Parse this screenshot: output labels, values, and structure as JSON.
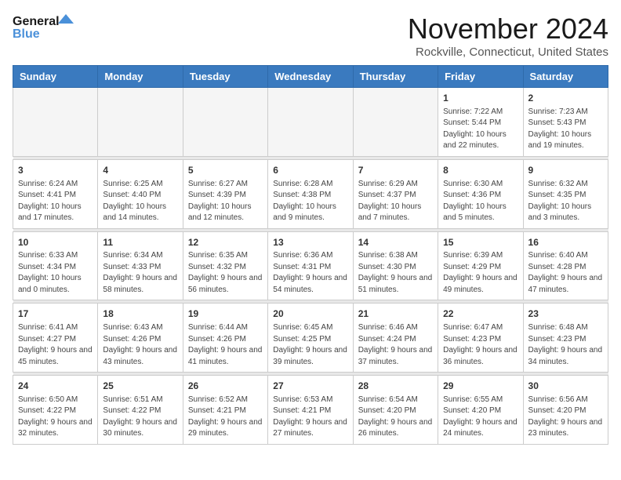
{
  "logo": {
    "line1": "General",
    "line2": "Blue"
  },
  "title": "November 2024",
  "location": "Rockville, Connecticut, United States",
  "weekdays": [
    "Sunday",
    "Monday",
    "Tuesday",
    "Wednesday",
    "Thursday",
    "Friday",
    "Saturday"
  ],
  "weeks": [
    [
      {
        "day": "",
        "info": ""
      },
      {
        "day": "",
        "info": ""
      },
      {
        "day": "",
        "info": ""
      },
      {
        "day": "",
        "info": ""
      },
      {
        "day": "",
        "info": ""
      },
      {
        "day": "1",
        "info": "Sunrise: 7:22 AM\nSunset: 5:44 PM\nDaylight: 10 hours and 22 minutes."
      },
      {
        "day": "2",
        "info": "Sunrise: 7:23 AM\nSunset: 5:43 PM\nDaylight: 10 hours and 19 minutes."
      }
    ],
    [
      {
        "day": "3",
        "info": "Sunrise: 6:24 AM\nSunset: 4:41 PM\nDaylight: 10 hours and 17 minutes."
      },
      {
        "day": "4",
        "info": "Sunrise: 6:25 AM\nSunset: 4:40 PM\nDaylight: 10 hours and 14 minutes."
      },
      {
        "day": "5",
        "info": "Sunrise: 6:27 AM\nSunset: 4:39 PM\nDaylight: 10 hours and 12 minutes."
      },
      {
        "day": "6",
        "info": "Sunrise: 6:28 AM\nSunset: 4:38 PM\nDaylight: 10 hours and 9 minutes."
      },
      {
        "day": "7",
        "info": "Sunrise: 6:29 AM\nSunset: 4:37 PM\nDaylight: 10 hours and 7 minutes."
      },
      {
        "day": "8",
        "info": "Sunrise: 6:30 AM\nSunset: 4:36 PM\nDaylight: 10 hours and 5 minutes."
      },
      {
        "day": "9",
        "info": "Sunrise: 6:32 AM\nSunset: 4:35 PM\nDaylight: 10 hours and 3 minutes."
      }
    ],
    [
      {
        "day": "10",
        "info": "Sunrise: 6:33 AM\nSunset: 4:34 PM\nDaylight: 10 hours and 0 minutes."
      },
      {
        "day": "11",
        "info": "Sunrise: 6:34 AM\nSunset: 4:33 PM\nDaylight: 9 hours and 58 minutes."
      },
      {
        "day": "12",
        "info": "Sunrise: 6:35 AM\nSunset: 4:32 PM\nDaylight: 9 hours and 56 minutes."
      },
      {
        "day": "13",
        "info": "Sunrise: 6:36 AM\nSunset: 4:31 PM\nDaylight: 9 hours and 54 minutes."
      },
      {
        "day": "14",
        "info": "Sunrise: 6:38 AM\nSunset: 4:30 PM\nDaylight: 9 hours and 51 minutes."
      },
      {
        "day": "15",
        "info": "Sunrise: 6:39 AM\nSunset: 4:29 PM\nDaylight: 9 hours and 49 minutes."
      },
      {
        "day": "16",
        "info": "Sunrise: 6:40 AM\nSunset: 4:28 PM\nDaylight: 9 hours and 47 minutes."
      }
    ],
    [
      {
        "day": "17",
        "info": "Sunrise: 6:41 AM\nSunset: 4:27 PM\nDaylight: 9 hours and 45 minutes."
      },
      {
        "day": "18",
        "info": "Sunrise: 6:43 AM\nSunset: 4:26 PM\nDaylight: 9 hours and 43 minutes."
      },
      {
        "day": "19",
        "info": "Sunrise: 6:44 AM\nSunset: 4:26 PM\nDaylight: 9 hours and 41 minutes."
      },
      {
        "day": "20",
        "info": "Sunrise: 6:45 AM\nSunset: 4:25 PM\nDaylight: 9 hours and 39 minutes."
      },
      {
        "day": "21",
        "info": "Sunrise: 6:46 AM\nSunset: 4:24 PM\nDaylight: 9 hours and 37 minutes."
      },
      {
        "day": "22",
        "info": "Sunrise: 6:47 AM\nSunset: 4:23 PM\nDaylight: 9 hours and 36 minutes."
      },
      {
        "day": "23",
        "info": "Sunrise: 6:48 AM\nSunset: 4:23 PM\nDaylight: 9 hours and 34 minutes."
      }
    ],
    [
      {
        "day": "24",
        "info": "Sunrise: 6:50 AM\nSunset: 4:22 PM\nDaylight: 9 hours and 32 minutes."
      },
      {
        "day": "25",
        "info": "Sunrise: 6:51 AM\nSunset: 4:22 PM\nDaylight: 9 hours and 30 minutes."
      },
      {
        "day": "26",
        "info": "Sunrise: 6:52 AM\nSunset: 4:21 PM\nDaylight: 9 hours and 29 minutes."
      },
      {
        "day": "27",
        "info": "Sunrise: 6:53 AM\nSunset: 4:21 PM\nDaylight: 9 hours and 27 minutes."
      },
      {
        "day": "28",
        "info": "Sunrise: 6:54 AM\nSunset: 4:20 PM\nDaylight: 9 hours and 26 minutes."
      },
      {
        "day": "29",
        "info": "Sunrise: 6:55 AM\nSunset: 4:20 PM\nDaylight: 9 hours and 24 minutes."
      },
      {
        "day": "30",
        "info": "Sunrise: 6:56 AM\nSunset: 4:20 PM\nDaylight: 9 hours and 23 minutes."
      }
    ]
  ]
}
